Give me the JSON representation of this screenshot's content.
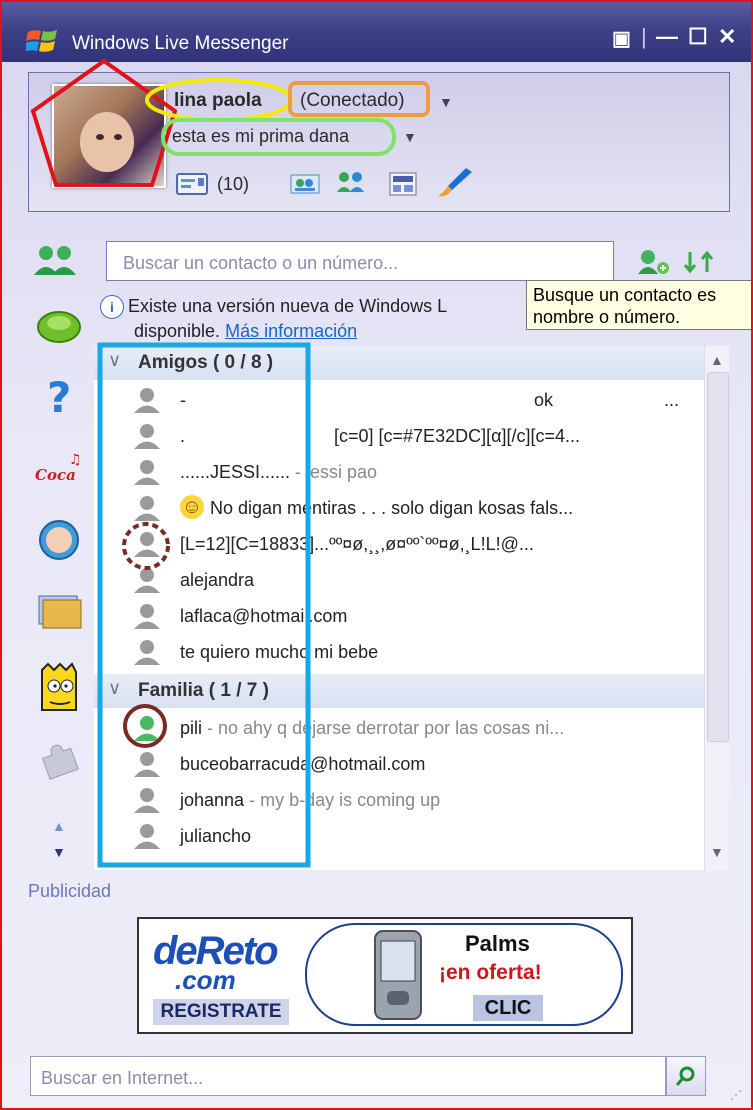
{
  "window": {
    "title": "Windows Live Messenger",
    "controls": {
      "menu": "▣",
      "sep": "|",
      "minimize": "—",
      "maximize": "☐",
      "close": "✕"
    }
  },
  "profile": {
    "name": "lina paola",
    "status": "(Conectado)",
    "personal_message": "esta es mi prima dana",
    "mail_count": "(10)"
  },
  "search": {
    "placeholder": "Buscar un contacto o un número...",
    "tooltip_line1": "Busque un contacto es",
    "tooltip_line2": "nombre o número."
  },
  "update_notice": {
    "text": "Existe una versión nueva de Windows L",
    "line2": "disponible.",
    "link": "Más información"
  },
  "groups": [
    {
      "title": "Amigos ( 0 / 8 )",
      "contacts": [
        {
          "name": "-",
          "extra": "ok",
          "tail": "..."
        },
        {
          "name": ".",
          "extra": "[c=0]   [c=#7E32DC][α][/c][c=4..."
        },
        {
          "name": "......JESSI......",
          "extra": " - jessi pao"
        },
        {
          "name": "No digan mentiras . . . solo digan kosas fals..."
        },
        {
          "name": "[L=12][C=18833]...ºº¤ø,¸¸,ø¤ºº`ºº¤ø,¸L!L!@..."
        },
        {
          "name": "alejandra"
        },
        {
          "name": "laflaca@hotmail.com"
        },
        {
          "name": "te quiero mucho mi bebe"
        }
      ]
    },
    {
      "title": "Familia ( 1 / 7 )",
      "contacts": [
        {
          "name": "pili",
          "extra": " - no ahy q dejarse derrotar por las cosas ni..."
        },
        {
          "name": "buceobarracuda@hotmail.com"
        },
        {
          "name": "johanna",
          "extra": " - my b-day is coming up"
        },
        {
          "name": "juliancho"
        }
      ]
    }
  ],
  "ad": {
    "label": "Publicidad",
    "brand1": "deReto",
    "brand2": ".com",
    "cta_left": "REGISTRATE",
    "product": "Palms",
    "offer": "¡en oferta!",
    "cta_right": "CLIC"
  },
  "websearch": {
    "placeholder": "Buscar en Internet..."
  },
  "colors": {
    "annotation_red": "#e0131b",
    "annotation_yellow": "#f5e900",
    "annotation_orange": "#f09a45",
    "annotation_green": "#7fe36a",
    "annotation_blue": "#17a9e6",
    "annotation_brown": "#7a2a24"
  }
}
